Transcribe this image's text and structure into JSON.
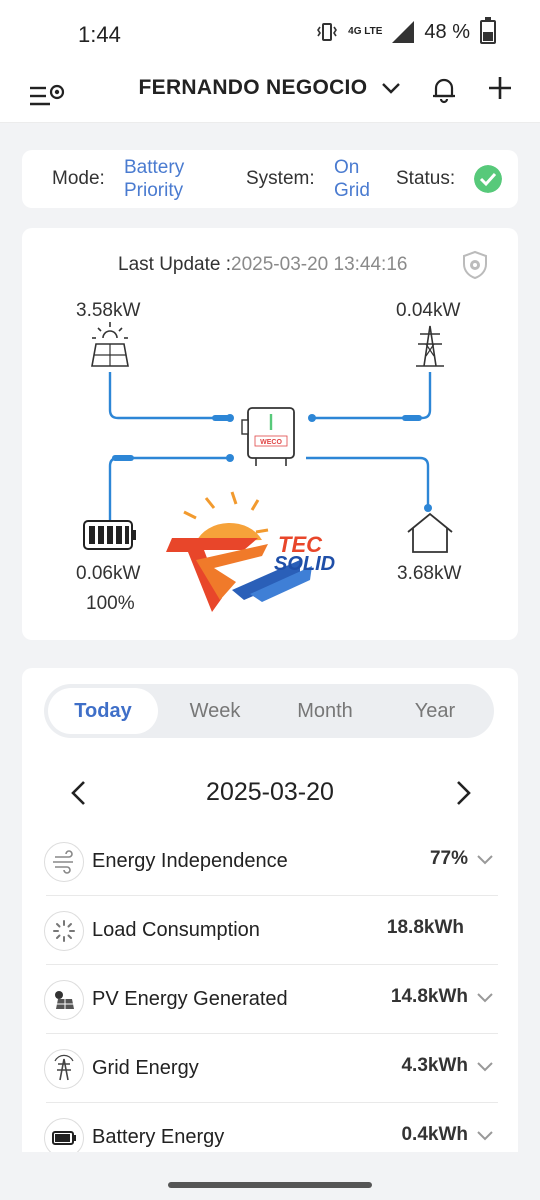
{
  "status_bar": {
    "time": "1:44",
    "network": "4G LTE",
    "battery_percent": "48 %",
    "icons": [
      "vibrate-icon",
      "signal-icon",
      "battery-icon"
    ]
  },
  "header": {
    "plant_name": "FERNANDO NEGOCIO",
    "icons": [
      "menu-settings-icon",
      "chevron-down-icon",
      "bell-icon",
      "plus-icon"
    ]
  },
  "summary": {
    "mode_label": "Mode",
    "mode_value_line1": "Battery",
    "mode_value_line2": "Priority",
    "system_label": "System",
    "system_value_line1": "On",
    "system_value_line2": "Grid",
    "status_label": "Status",
    "colon": ":",
    "status_color": "#57c97a"
  },
  "flow": {
    "last_update_label": "Last Update :",
    "last_update_value": "2025-03-20 13:44:16",
    "solar_power": "3.58kW",
    "grid_power": "0.04kW",
    "battery_power": "0.06kW",
    "battery_soc": "100%",
    "load_power": "3.68kW",
    "inverter_brand": "WECO",
    "logo_text_1": "TEC",
    "logo_text_2": "SOLID",
    "line_color": "#2d86d6"
  },
  "period_tabs": {
    "items": [
      "Today",
      "Week",
      "Month",
      "Year"
    ],
    "selected": "Today"
  },
  "date_nav": {
    "date": "2025-03-20"
  },
  "energy_list": [
    {
      "name": "Energy Independence",
      "value": "77%",
      "icon": "wind-icon",
      "expandable": true
    },
    {
      "name": "Load Consumption",
      "value": "18.8kWh",
      "icon": "loading-icon",
      "expandable": false
    },
    {
      "name": "PV Energy Generated",
      "value": "14.8kWh",
      "icon": "solar-panel-icon",
      "expandable": true
    },
    {
      "name": "Grid Energy",
      "value": "4.3kWh",
      "icon": "transmission-tower-icon",
      "expandable": true
    },
    {
      "name": "Battery Energy",
      "value": "0.4kWh",
      "icon": "battery-icon",
      "expandable": true
    }
  ],
  "colors": {
    "accent": "#3f6fc8",
    "link_blue": "#4a7bd0",
    "background": "#f2f3f5"
  }
}
